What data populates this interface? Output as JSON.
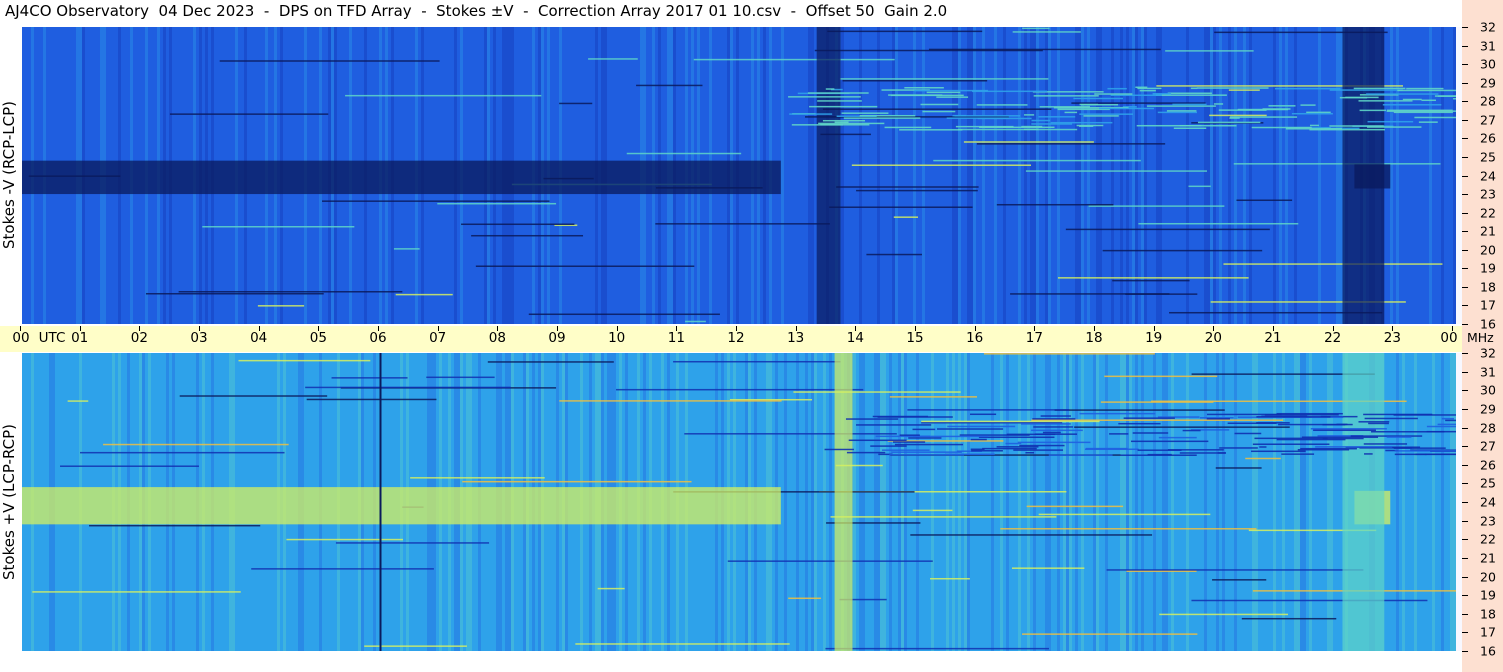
{
  "title": "AJ4CO Observatory  04 Dec 2023  -  DPS on TFD Array  -  Stokes ±V  -  Correction Array 2017 01 10.csv  -  Offset 50  Gain 2.0",
  "chart_data": [
    {
      "type": "heatmap",
      "panel": "top",
      "ylabel": "Stokes -V (RCP-LCP)",
      "x_unit": "UTC",
      "x_ticks": [
        "00",
        "01",
        "02",
        "03",
        "04",
        "05",
        "06",
        "07",
        "08",
        "09",
        "10",
        "11",
        "12",
        "13",
        "14",
        "15",
        "16",
        "17",
        "18",
        "19",
        "20",
        "21",
        "22",
        "23",
        "00"
      ],
      "x_range_hours": [
        0,
        24
      ],
      "y_unit": "MHz",
      "y_ticks": [
        32,
        31,
        30,
        29,
        28,
        27,
        26,
        25,
        24,
        23,
        22,
        21,
        20,
        19,
        18,
        17,
        16
      ],
      "y_range_mhz": [
        16,
        32
      ],
      "colormap": [
        "#0a1a5c",
        "#1030b0",
        "#1f5fe0",
        "#2fa2ea",
        "#5fd6c8",
        "#d6f060",
        "#f0c040",
        "#ff4020"
      ],
      "features": [
        {
          "kind": "band",
          "f_range_mhz": [
            23.0,
            24.8
          ],
          "t_range_hours": [
            0,
            12.7
          ],
          "level": -0.8
        },
        {
          "kind": "band",
          "f_range_mhz": [
            23.3,
            24.6
          ],
          "t_range_hours": [
            22.3,
            22.9
          ],
          "level": -0.9
        },
        {
          "kind": "column",
          "t_range_hours": [
            13.3,
            13.7
          ],
          "f_range_mhz": [
            16,
            32
          ],
          "level": -0.7
        },
        {
          "kind": "column",
          "t_range_hours": [
            22.1,
            22.8
          ],
          "f_range_mhz": [
            16,
            32
          ],
          "level": -0.6
        },
        {
          "kind": "activity",
          "t_range_hours": [
            12.8,
            24
          ],
          "f_range_mhz": [
            26.5,
            28.8
          ],
          "level": 0.8
        }
      ]
    },
    {
      "type": "heatmap",
      "panel": "bottom",
      "ylabel": "Stokes +V (LCP-RCP)",
      "x_unit": "UTC",
      "x_ticks": [
        "00",
        "01",
        "02",
        "03",
        "04",
        "05",
        "06",
        "07",
        "08",
        "09",
        "10",
        "11",
        "12",
        "13",
        "14",
        "15",
        "16",
        "17",
        "18",
        "19",
        "20",
        "21",
        "22",
        "23",
        "00"
      ],
      "x_range_hours": [
        0,
        24
      ],
      "y_unit": "MHz",
      "y_ticks": [
        32,
        31,
        30,
        29,
        28,
        27,
        26,
        25,
        24,
        23,
        22,
        21,
        20,
        19,
        18,
        17,
        16
      ],
      "y_range_mhz": [
        16,
        32
      ],
      "colormap": [
        "#0a1a5c",
        "#1030b0",
        "#1f5fe0",
        "#2fa2ea",
        "#5fd6c8",
        "#d6f060",
        "#f0c040",
        "#ff4020"
      ],
      "features": [
        {
          "kind": "band",
          "f_range_mhz": [
            22.8,
            24.8
          ],
          "t_range_hours": [
            0,
            12.7
          ],
          "level": 0.7
        },
        {
          "kind": "band",
          "f_range_mhz": [
            22.8,
            24.6
          ],
          "t_range_hours": [
            22.3,
            22.9
          ],
          "level": 0.8
        },
        {
          "kind": "column",
          "t_range_hours": [
            13.6,
            13.9
          ],
          "f_range_mhz": [
            16,
            32
          ],
          "level": 0.5
        },
        {
          "kind": "column",
          "t_range_hours": [
            22.1,
            22.8
          ],
          "f_range_mhz": [
            16,
            32
          ],
          "level": 0.4
        },
        {
          "kind": "activity",
          "t_range_hours": [
            12.8,
            24
          ],
          "f_range_mhz": [
            26.5,
            28.8
          ],
          "level": -0.8
        },
        {
          "kind": "line",
          "t_hours": 6.0,
          "level": -1.0
        }
      ]
    }
  ],
  "mhz_label": "MHz",
  "utc_label": "UTC"
}
